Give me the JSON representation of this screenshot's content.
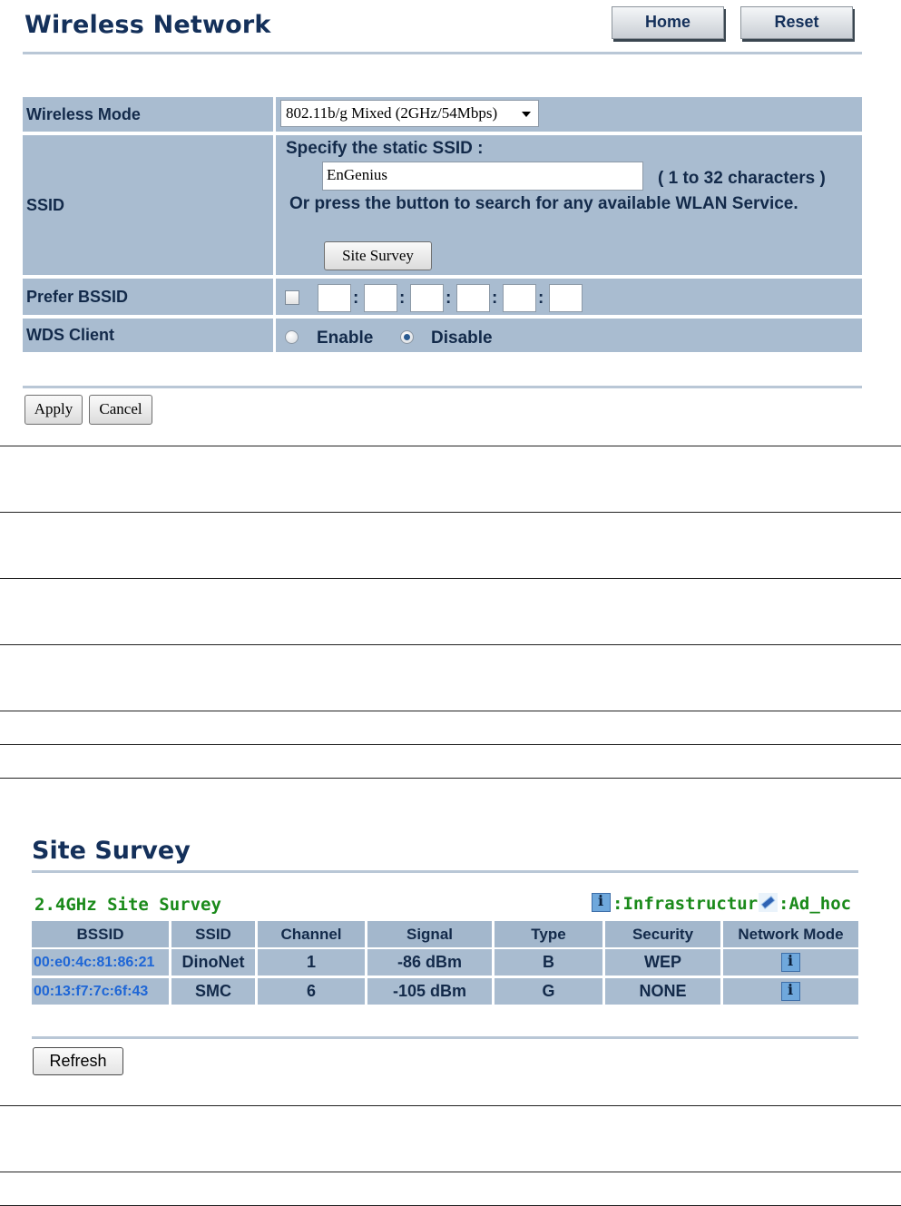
{
  "wireless_network": {
    "title": "Wireless Network",
    "buttons": {
      "home": "Home",
      "reset": "Reset"
    },
    "rows": {
      "wireless_mode": {
        "label": "Wireless Mode",
        "selected": "802.11b/g Mixed (2GHz/54Mbps)"
      },
      "ssid": {
        "label": "SSID",
        "specify_text": "Specify the static SSID  :",
        "value": "EnGenius",
        "hint": "( 1 to 32 characters )",
        "search_text": "Or press the button to search for any available WLAN Service.",
        "site_survey_button": "Site Survey"
      },
      "prefer_bssid": {
        "label": "Prefer BSSID",
        "checked": false,
        "separator": ":"
      },
      "wds_client": {
        "label": "WDS Client",
        "options": [
          "Enable",
          "Disable"
        ],
        "selected": "Disable"
      }
    },
    "actions": {
      "apply": "Apply",
      "cancel": "Cancel"
    }
  },
  "site_survey": {
    "title": "Site Survey",
    "subtitle": "2.4GHz Site Survey",
    "legend": {
      "infrastructure": ":Infrastructure",
      "ad_hoc": ":Ad_hoc"
    },
    "columns": [
      "BSSID",
      "SSID",
      "Channel",
      "Signal",
      "Type",
      "Security",
      "Network Mode"
    ],
    "rows": [
      {
        "bssid": "00:e0:4c:81:86:21",
        "ssid": "DinoNet",
        "channel": "1",
        "signal": "-86 dBm",
        "type": "B",
        "security": "WEP",
        "network_mode": "infrastructure-icon"
      },
      {
        "bssid": "00:13:f7:7c:6f:43",
        "ssid": "SMC",
        "channel": "6",
        "signal": "-105 dBm",
        "type": "G",
        "security": "NONE",
        "network_mode": "infrastructure-icon"
      }
    ],
    "refresh_button": "Refresh"
  }
}
